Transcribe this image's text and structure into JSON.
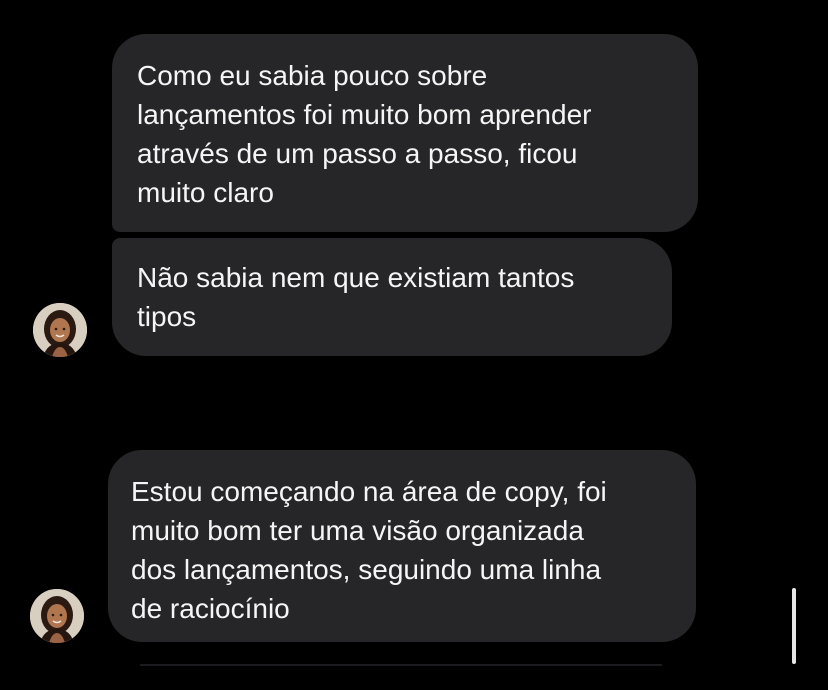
{
  "chat": {
    "messages": [
      {
        "text": "Como eu sabia pouco sobre\nlançamentos foi muito bom aprender\natravés de um passo a passo, ficou\nmuito claro"
      },
      {
        "text": "Não sabia nem que existiam tantos\ntipos"
      },
      {
        "text": "Estou começando na área de copy, foi\nmuito bom ter uma visão organizada\ndos lançamentos, seguindo uma linha\nde raciocínio"
      }
    ]
  },
  "colors": {
    "background": "#000000",
    "bubble": "#262628",
    "text": "#f5f5f5"
  },
  "icons": {
    "avatar": "user-avatar-photo"
  }
}
